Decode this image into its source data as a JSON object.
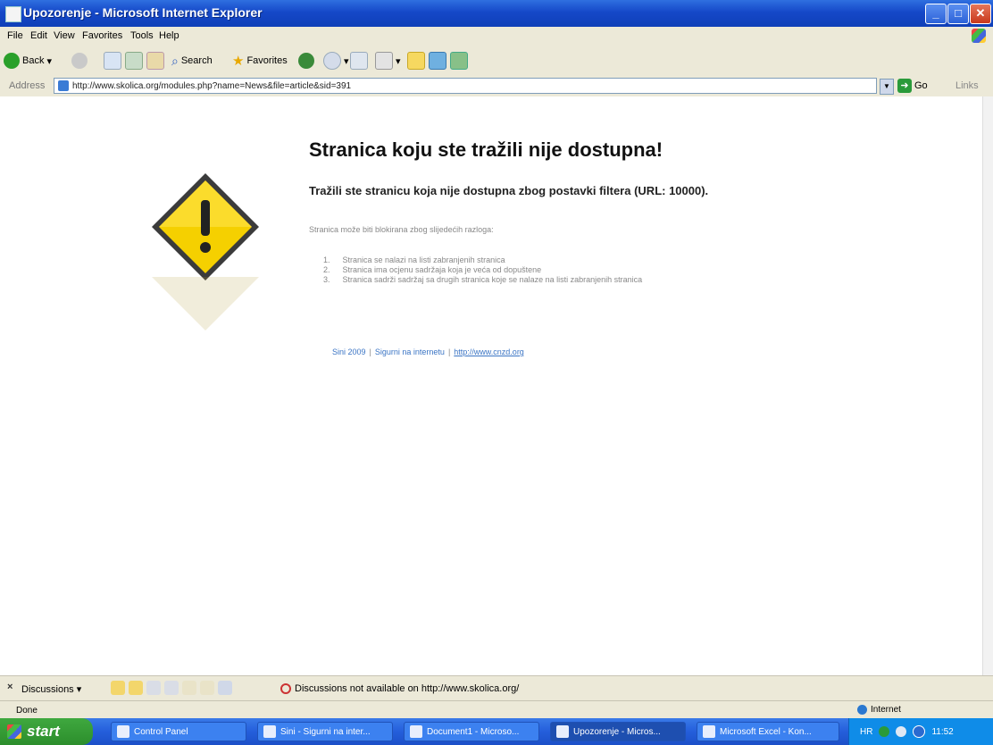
{
  "window": {
    "title": "Upozorenje - Microsoft Internet Explorer"
  },
  "menu": [
    "File",
    "Edit",
    "View",
    "Favorites",
    "Tools",
    "Help"
  ],
  "toolbar": {
    "back": "Back",
    "search": "Search",
    "favorites": "Favorites"
  },
  "address": {
    "label": "Address",
    "url": "http://www.skolica.org/modules.php?name=News&file=article&sid=391",
    "go": "Go",
    "links": "Links"
  },
  "page": {
    "heading": "Stranica koju ste tražili nije dostupna!",
    "subheading": "Tražili ste stranicu koja nije dostupna zbog postavki filtera (URL: 10000).",
    "reason_intro": "Stranica može biti blokirana zbog slijedećih razloga:",
    "reasons": [
      {
        "num": "1.",
        "text": "Stranica se nalazi na listi zabranjenih stranica"
      },
      {
        "num": "2.",
        "text": "Stranica ima ocjenu sadržaja koja je veća od dopuštene"
      },
      {
        "num": "3.",
        "text": "Stranica sadrži sadržaj sa drugih stranica koje se nalaze na listi zabranjenih stranica"
      }
    ],
    "footer": {
      "link1": "Sini 2009",
      "sep": "|",
      "link2": "Sigurni na internetu",
      "link3": "http://www.cnzd.org"
    }
  },
  "discussions": {
    "close": "×",
    "label": "Discussions ▾",
    "message": "Discussions not available on http://www.skolica.org/"
  },
  "status": {
    "text": "Done",
    "zone": "Internet"
  },
  "taskbar": {
    "start": "start",
    "tasks": [
      "Control Panel",
      "Sini - Sigurni na inter...",
      "Document1 - Microso...",
      "Upozorenje - Micros...",
      "Microsoft Excel - Kon..."
    ],
    "tray_lang": "HR",
    "clock": "11:52"
  },
  "colors": {
    "accent": "#245edb",
    "link": "#3a74c4",
    "warning": "#f5d000"
  }
}
